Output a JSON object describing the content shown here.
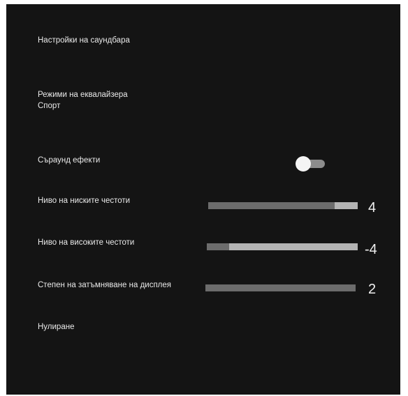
{
  "settings": {
    "title": "Настройки на саундбара",
    "equalizer": {
      "label": "Режими на еквалайзера",
      "value": "Спорт"
    },
    "surround": {
      "label": "Съраунд ефекти",
      "enabled": false
    },
    "bass": {
      "label": "Ниво на ниските честоти",
      "value": "4"
    },
    "treble": {
      "label": "Ниво на високите честоти",
      "value": "-4"
    },
    "dimmer": {
      "label": "Степен на затъмняване на дисплея",
      "value": "2"
    },
    "reset": {
      "label": "Нулиране"
    }
  },
  "colors": {
    "background": "#141414",
    "text": "#e9e9e9",
    "slider_track": "#6c6c6c",
    "slider_highlight": "#b4b4b4"
  }
}
